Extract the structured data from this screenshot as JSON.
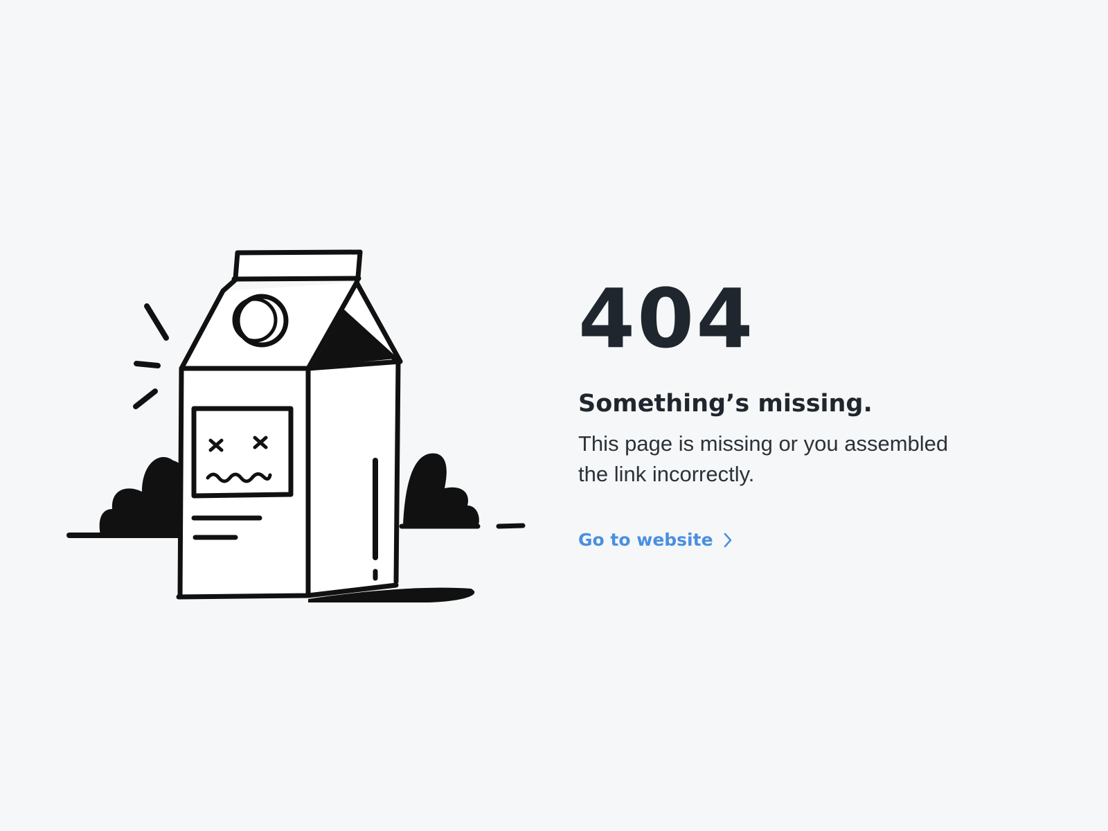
{
  "error": {
    "code": "404",
    "headline": "Something’s missing.",
    "message": "This page is missing or you assembled the link incorrectly."
  },
  "cta": {
    "label": "Go to website",
    "icon": "chevron-right-icon"
  },
  "colors": {
    "background": "#f5f7f8",
    "text": "#1f262d",
    "link": "#4a8fe0",
    "ink": "#111111"
  },
  "illustration": {
    "icon": "sad-milk-carton-illustration"
  }
}
